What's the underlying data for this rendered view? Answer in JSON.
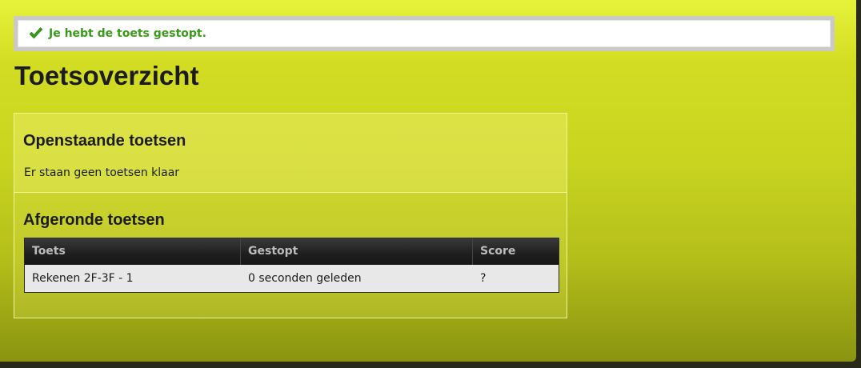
{
  "notice": {
    "icon": "checkmark-icon",
    "text": "Je hebt de toets gestopt.",
    "color": "#3a9a1a"
  },
  "page_title": "Toetsoverzicht",
  "open_tests": {
    "title": "Openstaande toetsen",
    "empty_message": "Er staan geen toetsen klaar"
  },
  "completed_tests": {
    "title": "Afgeronde toetsen",
    "columns": [
      "Toets",
      "Gestopt",
      "Score"
    ],
    "rows": [
      [
        "Rekenen 2F-3F - 1",
        "0 seconden geleden",
        "?"
      ]
    ]
  },
  "colors": {
    "background_top": "#e6f23a",
    "background_bottom": "#8a9410",
    "table_header": "#1e1e1e",
    "table_row": "#e8e8e8"
  }
}
